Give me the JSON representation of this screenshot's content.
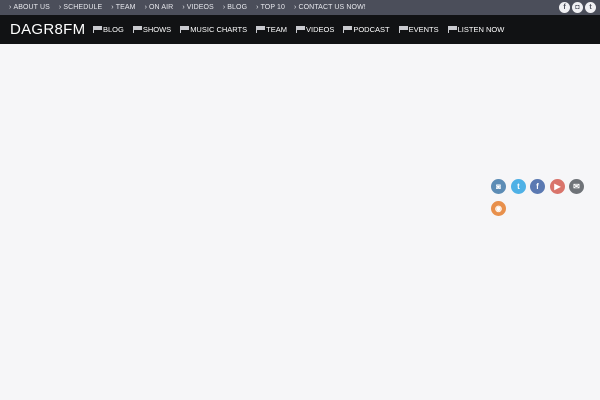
{
  "topbar": {
    "items": [
      {
        "label": "ABOUT US"
      },
      {
        "label": "SCHEDULE"
      },
      {
        "label": "TEAM"
      },
      {
        "label": "ON AIR"
      },
      {
        "label": "VIDEOS"
      },
      {
        "label": "BLOG"
      },
      {
        "label": "TOP 10"
      },
      {
        "label": "CONTACT US NOW!"
      }
    ],
    "social": [
      {
        "icon": "facebook-icon",
        "glyph": "f"
      },
      {
        "icon": "instagram-icon",
        "glyph": "◘"
      },
      {
        "icon": "twitter-icon",
        "glyph": "t"
      }
    ]
  },
  "header": {
    "logo": "DAGR8FM",
    "nav": [
      {
        "label": "BLOG"
      },
      {
        "label": "SHOWS"
      },
      {
        "label": "MUSIC CHARTS"
      },
      {
        "label": "TEAM"
      },
      {
        "label": "VIDEOS"
      },
      {
        "label": "PODCAST"
      },
      {
        "label": "EVENTS"
      },
      {
        "label": "LISTEN NOW"
      }
    ]
  },
  "social_icons": [
    {
      "icon": "instagram-icon",
      "glyph": "◙",
      "color": "#5c8cb5"
    },
    {
      "icon": "twitter-icon",
      "glyph": "t",
      "color": "#4fb1e6"
    },
    {
      "icon": "facebook-icon",
      "glyph": "f",
      "color": "#5b79b2"
    },
    {
      "icon": "youtube-icon",
      "glyph": "▶",
      "color": "#d9746b"
    },
    {
      "icon": "email-icon",
      "glyph": "✉",
      "color": "#6f7378"
    },
    {
      "icon": "rss-icon",
      "glyph": "◉",
      "color": "#e8904c"
    }
  ],
  "colors": {
    "topbar": "#4b4e5a",
    "mainbar": "#111214",
    "background": "#f6f6f8"
  }
}
